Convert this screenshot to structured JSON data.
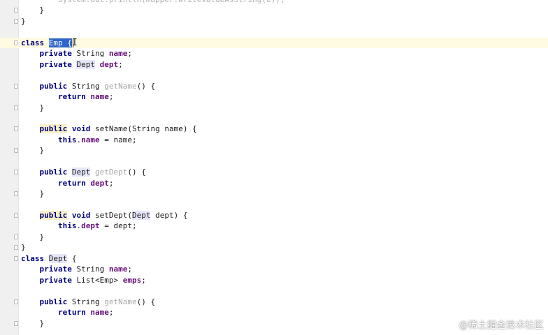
{
  "editor": {
    "lines": [
      {
        "tokens": [
          {
            "t": "        System.out.println(mapper.writeValueAsString(e));",
            "c": "faded"
          }
        ]
      },
      {
        "tokens": [
          {
            "t": "    }",
            "c": ""
          }
        ],
        "fold": true
      },
      {
        "tokens": [
          {
            "t": "}",
            "c": ""
          }
        ],
        "fold": true
      },
      {
        "tokens": [
          {
            "t": "",
            "c": ""
          }
        ]
      },
      {
        "tokens": [
          {
            "t": "class",
            "c": "kw"
          },
          {
            "t": " ",
            "c": ""
          },
          {
            "t": "Emp",
            "c": "sel"
          },
          {
            "t": " {",
            "c": "sel"
          }
        ],
        "current": true,
        "caret": true,
        "fold": true
      },
      {
        "tokens": [
          {
            "t": "    ",
            "c": ""
          },
          {
            "t": "private",
            "c": "kw"
          },
          {
            "t": " String ",
            "c": ""
          },
          {
            "t": "name",
            "c": "field"
          },
          {
            "t": ";",
            "c": ""
          }
        ]
      },
      {
        "tokens": [
          {
            "t": "    ",
            "c": ""
          },
          {
            "t": "private",
            "c": "kw"
          },
          {
            "t": " ",
            "c": ""
          },
          {
            "t": "Dept",
            "c": "ref-hl"
          },
          {
            "t": " ",
            "c": ""
          },
          {
            "t": "dept",
            "c": "field"
          },
          {
            "t": ";",
            "c": ""
          }
        ]
      },
      {
        "tokens": [
          {
            "t": "",
            "c": ""
          }
        ]
      },
      {
        "tokens": [
          {
            "t": "    ",
            "c": ""
          },
          {
            "t": "public",
            "c": "kw"
          },
          {
            "t": " String ",
            "c": ""
          },
          {
            "t": "getName",
            "c": "method"
          },
          {
            "t": "() {",
            "c": ""
          }
        ],
        "fold": true
      },
      {
        "tokens": [
          {
            "t": "        ",
            "c": ""
          },
          {
            "t": "return",
            "c": "kw"
          },
          {
            "t": " ",
            "c": ""
          },
          {
            "t": "name",
            "c": "field"
          },
          {
            "t": ";",
            "c": ""
          }
        ]
      },
      {
        "tokens": [
          {
            "t": "    }",
            "c": ""
          }
        ],
        "fold": true
      },
      {
        "tokens": [
          {
            "t": "",
            "c": ""
          }
        ]
      },
      {
        "tokens": [
          {
            "t": "    ",
            "c": ""
          },
          {
            "t": "public",
            "c": "kw warn-hl"
          },
          {
            "t": " ",
            "c": ""
          },
          {
            "t": "void",
            "c": "kw"
          },
          {
            "t": " setName(String name) {",
            "c": ""
          }
        ],
        "fold": true
      },
      {
        "tokens": [
          {
            "t": "        ",
            "c": ""
          },
          {
            "t": "this",
            "c": "kw"
          },
          {
            "t": ".",
            "c": ""
          },
          {
            "t": "name",
            "c": "field"
          },
          {
            "t": " = name;",
            "c": ""
          }
        ]
      },
      {
        "tokens": [
          {
            "t": "    }",
            "c": ""
          }
        ],
        "fold": true
      },
      {
        "tokens": [
          {
            "t": "",
            "c": ""
          }
        ]
      },
      {
        "tokens": [
          {
            "t": "    ",
            "c": ""
          },
          {
            "t": "public",
            "c": "kw"
          },
          {
            "t": " ",
            "c": ""
          },
          {
            "t": "Dept",
            "c": "ref-hl"
          },
          {
            "t": " ",
            "c": ""
          },
          {
            "t": "getDept",
            "c": "method"
          },
          {
            "t": "() {",
            "c": ""
          }
        ],
        "fold": true
      },
      {
        "tokens": [
          {
            "t": "        ",
            "c": ""
          },
          {
            "t": "return",
            "c": "kw"
          },
          {
            "t": " ",
            "c": ""
          },
          {
            "t": "dept",
            "c": "field"
          },
          {
            "t": ";",
            "c": ""
          }
        ]
      },
      {
        "tokens": [
          {
            "t": "    }",
            "c": ""
          }
        ],
        "fold": true
      },
      {
        "tokens": [
          {
            "t": "",
            "c": ""
          }
        ]
      },
      {
        "tokens": [
          {
            "t": "    ",
            "c": ""
          },
          {
            "t": "public",
            "c": "kw warn-hl"
          },
          {
            "t": " ",
            "c": ""
          },
          {
            "t": "void",
            "c": "kw"
          },
          {
            "t": " setDept(",
            "c": ""
          },
          {
            "t": "Dept",
            "c": "ref-hl"
          },
          {
            "t": " dept) {",
            "c": ""
          }
        ],
        "fold": true
      },
      {
        "tokens": [
          {
            "t": "        ",
            "c": ""
          },
          {
            "t": "this",
            "c": "kw"
          },
          {
            "t": ".",
            "c": ""
          },
          {
            "t": "dept",
            "c": "field"
          },
          {
            "t": " = dept;",
            "c": ""
          }
        ]
      },
      {
        "tokens": [
          {
            "t": "    }",
            "c": ""
          }
        ],
        "fold": true
      },
      {
        "tokens": [
          {
            "t": "}",
            "c": ""
          }
        ],
        "fold": true
      },
      {
        "tokens": [
          {
            "t": "class",
            "c": "kw"
          },
          {
            "t": " ",
            "c": ""
          },
          {
            "t": "Dept",
            "c": "ref-hl"
          },
          {
            "t": " {",
            "c": ""
          }
        ],
        "fold": true
      },
      {
        "tokens": [
          {
            "t": "    ",
            "c": ""
          },
          {
            "t": "private",
            "c": "kw"
          },
          {
            "t": " String ",
            "c": ""
          },
          {
            "t": "name",
            "c": "field"
          },
          {
            "t": ";",
            "c": ""
          }
        ]
      },
      {
        "tokens": [
          {
            "t": "    ",
            "c": ""
          },
          {
            "t": "private",
            "c": "kw"
          },
          {
            "t": " List<Emp> ",
            "c": ""
          },
          {
            "t": "emps",
            "c": "field"
          },
          {
            "t": ";",
            "c": ""
          }
        ]
      },
      {
        "tokens": [
          {
            "t": "",
            "c": ""
          }
        ]
      },
      {
        "tokens": [
          {
            "t": "    ",
            "c": ""
          },
          {
            "t": "public",
            "c": "kw"
          },
          {
            "t": " String ",
            "c": ""
          },
          {
            "t": "getName",
            "c": "method"
          },
          {
            "t": "() {",
            "c": ""
          }
        ],
        "fold": true
      },
      {
        "tokens": [
          {
            "t": "        ",
            "c": ""
          },
          {
            "t": "return",
            "c": "kw"
          },
          {
            "t": " ",
            "c": ""
          },
          {
            "t": "name",
            "c": "field"
          },
          {
            "t": ";",
            "c": ""
          }
        ]
      },
      {
        "tokens": [
          {
            "t": "    }",
            "c": ""
          }
        ],
        "fold": true
      }
    ]
  },
  "watermark": "@稀土掘金技术社区"
}
